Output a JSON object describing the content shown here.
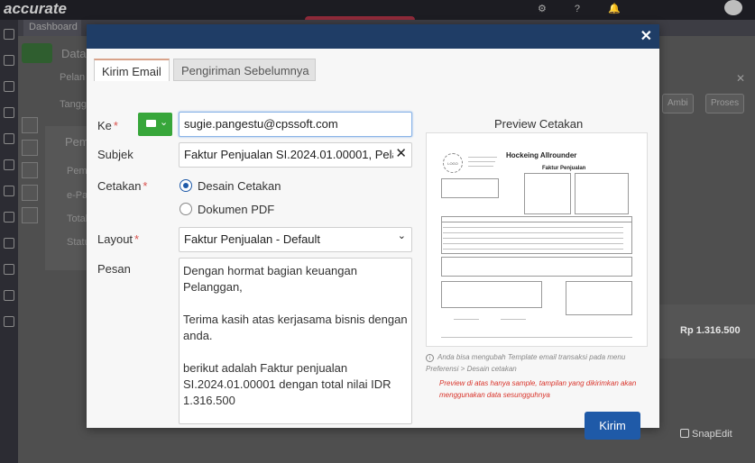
{
  "background": {
    "logo": "accurate",
    "logo_tag": "",
    "user_name": "",
    "user_location": "",
    "dashboard_tab": "Dashboard",
    "fragments": [
      "Data",
      "Pelan",
      "Tangg",
      "Pem",
      "Pem",
      "e-Pa",
      "Total",
      "Statu"
    ],
    "right_buttons": [
      "Ambi",
      "Proses"
    ],
    "total_value": "Rp 1.316.500",
    "watermark": "SnapEdit"
  },
  "modal": {
    "close_icon": "close-icon",
    "tabs": [
      {
        "label": "Kirim Email",
        "active": true
      },
      {
        "label": "Pengiriman Sebelumnya",
        "active": false
      }
    ],
    "form": {
      "to_label": "Ke",
      "to_value": "sugie.pangestu@cpssoft.com",
      "subject_label": "Subjek",
      "subject_value": "Faktur Penjualan SI.2024.01.00001, Pelan",
      "print_label": "Cetakan",
      "print_options": [
        {
          "label": "Desain Cetakan",
          "selected": true
        },
        {
          "label": "Dokumen PDF",
          "selected": false
        }
      ],
      "layout_label": "Layout",
      "layout_value": "Faktur Penjualan - Default",
      "message_label": "Pesan",
      "message_lines": [
        "Dengan hormat bagian keuangan",
        "Pelanggan,",
        "",
        "Terima kasih atas kerjasama bisnis dengan",
        "anda.",
        "",
        "berikut adalah Faktur penjualan",
        "SI.2024.01.00001 dengan total nilai IDR",
        "1.316.500"
      ]
    },
    "preview": {
      "title": "Preview Cetakan",
      "doc_heading": "Hockeing Allrounder",
      "doc_subtitle": "Faktur Penjualan",
      "info_note": "Anda bisa mengubah Template email transaksi pada menu Preferensi > Desain cetakan",
      "warning_note": "Preview di atas hanya sample, tampilan yang dikirimkan akan menggunakan data sesungguhnya"
    },
    "send_label": "Kirim"
  },
  "colors": {
    "header": "#1f3d66",
    "send": "#1f5aa8",
    "to_button": "#37a63a",
    "warning": "#d9342b",
    "required": "#d9534f"
  }
}
